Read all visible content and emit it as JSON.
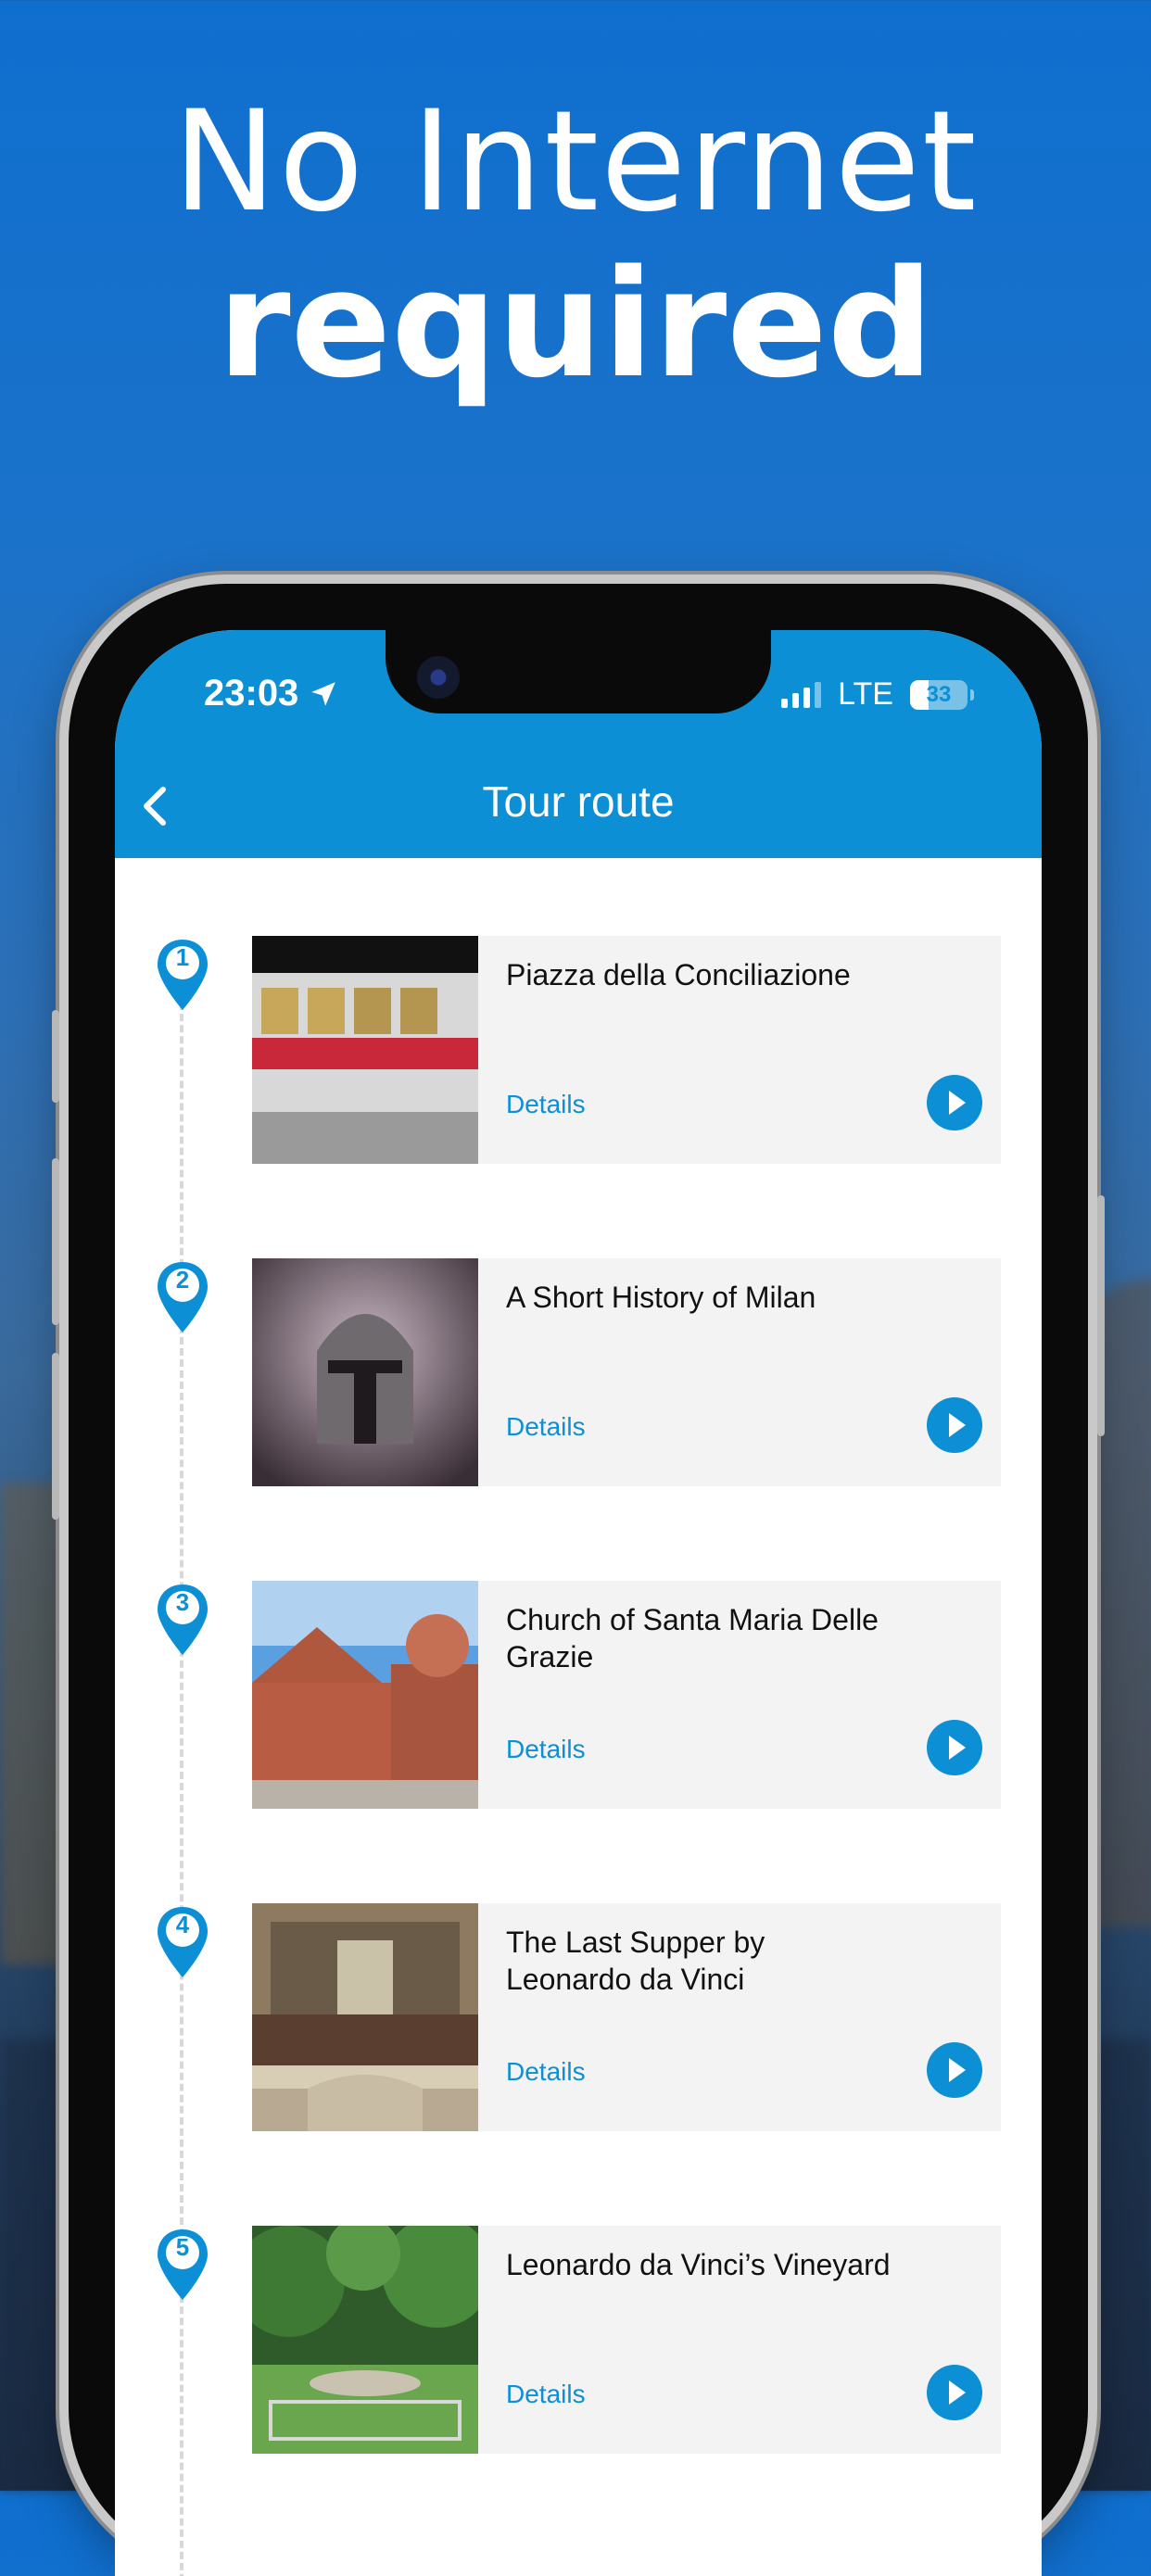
{
  "promo": {
    "line1": "No Internet",
    "line2": "required"
  },
  "status_bar": {
    "time": "23:03",
    "network": "LTE",
    "battery": "33"
  },
  "header": {
    "title": "Tour route",
    "back_icon": "chevron-left-icon"
  },
  "stops": [
    {
      "number": "1",
      "title": "Piazza della Conciliazione",
      "details_label": "Details"
    },
    {
      "number": "2",
      "title": "A Short History of Milan",
      "details_label": "Details"
    },
    {
      "number": "3",
      "title": "Church of Santa Maria Delle Grazie",
      "details_label": "Details"
    },
    {
      "number": "4",
      "title": "The Last Supper by Leonardo da Vinci",
      "details_label": "Details"
    },
    {
      "number": "5",
      "title": "Leonardo da Vinci’s Vineyard",
      "details_label": "Details"
    }
  ],
  "colors": {
    "accent": "#0d8fd6",
    "card_bg": "#f3f3f3"
  }
}
